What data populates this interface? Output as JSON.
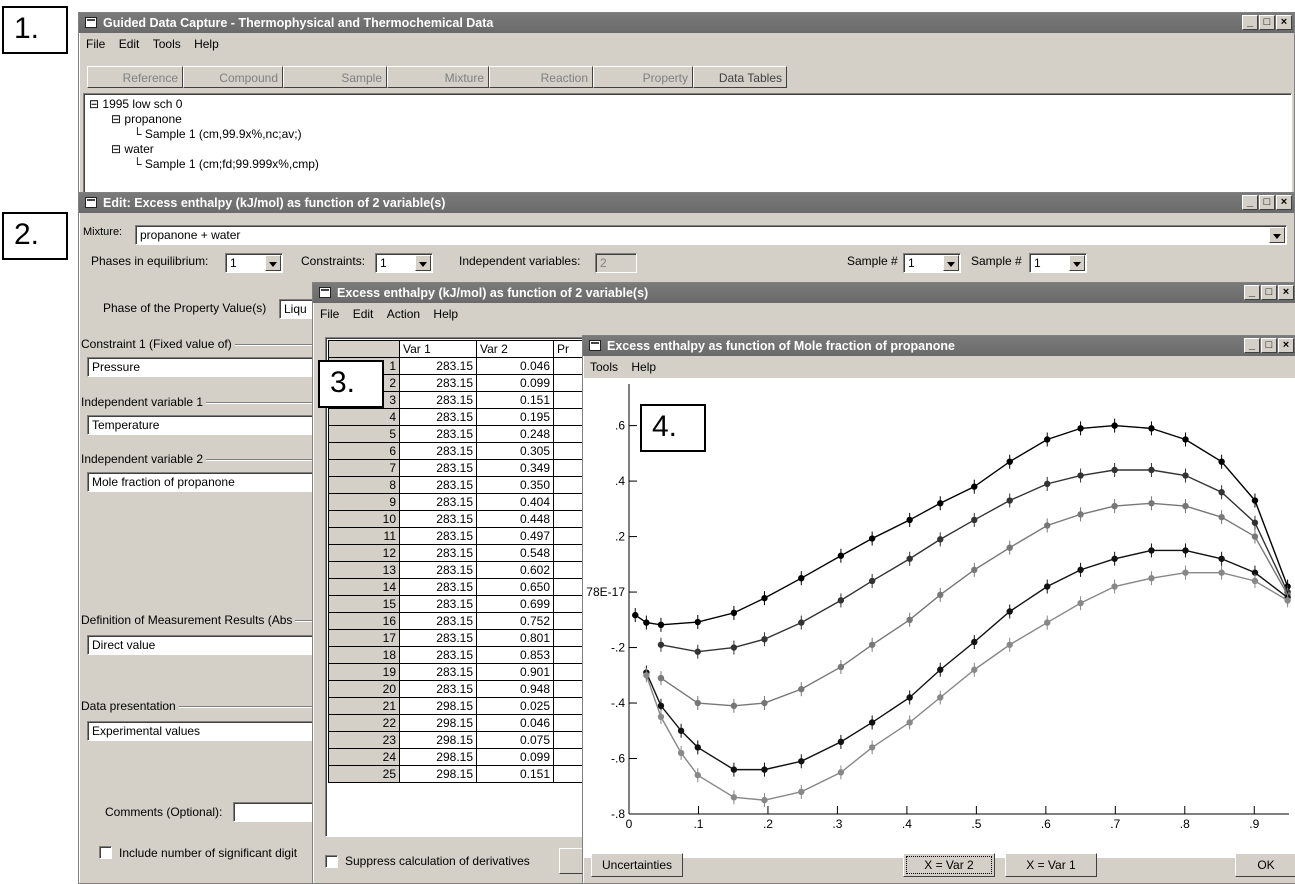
{
  "callouts": {
    "c1": "1.",
    "c2": "2.",
    "c3": "3.",
    "c4": "4."
  },
  "win1": {
    "title": "Guided Data Capture - Thermophysical and Thermochemical Data",
    "menu": [
      "File",
      "Edit",
      "Tools",
      "Help"
    ],
    "tabs": [
      "Reference",
      "Compound",
      "Sample",
      "Mixture",
      "Reaction",
      "Property",
      "Data Tables"
    ],
    "tree": {
      "root": "1995 low sch 0",
      "node1": "propanone",
      "node1_child": "Sample 1 (cm,99.9x%,nc;av;)",
      "node2": "water",
      "node2_child": "Sample 1 (cm;fd;99.999x%,cmp)"
    }
  },
  "win2": {
    "title": "Edit: Excess enthalpy (kJ/mol) as function of 2 variable(s)",
    "mixture_label": "Mixture:",
    "mixture_value": "propanone + water",
    "phases_label": "Phases in equilibrium:",
    "phases_value": "1",
    "constraints_label": "Constraints:",
    "constraints_value": "1",
    "indep_label": "Independent variables:",
    "indep_value": "2",
    "sample1_label": "Sample #",
    "sample1_value": "1",
    "sample2_label": "Sample #",
    "sample2_value": "1",
    "phase_prop_label": "Phase of the Property Value(s)",
    "phase_prop_value": "Liqu",
    "constraint1_label": "Constraint 1 (Fixed value of)",
    "constraint1_value": "Pressure",
    "indep1_label": "Independent variable 1",
    "indep1_value": "Temperature",
    "indep2_label": "Independent variable 2",
    "indep2_value": "Mole fraction of propanone",
    "definition_label": "Definition of Measurement Results (Abs",
    "definition_value": "Direct value",
    "presentation_label": "Data presentation",
    "presentation_value": "Experimental values",
    "comments_label": "Comments (Optional):",
    "sigdig_label": "Include number of significant digit"
  },
  "win3": {
    "title": "Excess enthalpy (kJ/mol) as function of 2 variable(s)",
    "menu": [
      "File",
      "Edit",
      "Action",
      "Help"
    ],
    "headers": [
      "Var 1",
      "Var 2",
      "Pr"
    ],
    "rows": [
      [
        "1",
        "283.15",
        "0.046"
      ],
      [
        "2",
        "283.15",
        "0.099"
      ],
      [
        "3",
        "283.15",
        "0.151"
      ],
      [
        "4",
        "283.15",
        "0.195"
      ],
      [
        "5",
        "283.15",
        "0.248"
      ],
      [
        "6",
        "283.15",
        "0.305"
      ],
      [
        "7",
        "283.15",
        "0.349"
      ],
      [
        "8",
        "283.15",
        "0.350"
      ],
      [
        "9",
        "283.15",
        "0.404"
      ],
      [
        "10",
        "283.15",
        "0.448"
      ],
      [
        "11",
        "283.15",
        "0.497"
      ],
      [
        "12",
        "283.15",
        "0.548"
      ],
      [
        "13",
        "283.15",
        "0.602"
      ],
      [
        "14",
        "283.15",
        "0.650"
      ],
      [
        "15",
        "283.15",
        "0.699"
      ],
      [
        "16",
        "283.15",
        "0.752"
      ],
      [
        "17",
        "283.15",
        "0.801"
      ],
      [
        "18",
        "283.15",
        "0.853"
      ],
      [
        "19",
        "283.15",
        "0.901"
      ],
      [
        "20",
        "283.15",
        "0.948"
      ],
      [
        "21",
        "298.15",
        "0.025"
      ],
      [
        "22",
        "298.15",
        "0.046"
      ],
      [
        "23",
        "298.15",
        "0.075"
      ],
      [
        "24",
        "298.15",
        "0.099"
      ],
      [
        "25",
        "298.15",
        "0.151"
      ]
    ],
    "suppress_label": "Suppress calculation of derivatives"
  },
  "win4": {
    "title": "Excess enthalpy as function of Mole fraction of propanone",
    "menu": [
      "Tools",
      "Help"
    ],
    "btn_uncert": "Uncertainties",
    "btn_var2": "X = Var 2",
    "btn_var1": "X = Var 1",
    "btn_ok": "OK"
  },
  "chart_data": {
    "type": "scatter",
    "xlim": [
      0,
      0.95
    ],
    "ylim": [
      -0.8,
      0.75
    ],
    "x_ticks": [
      "0",
      ".1",
      ".2",
      ".3",
      ".4",
      ".5",
      ".6",
      ".7",
      ".8",
      ".9"
    ],
    "y_ticks": [
      ".6",
      ".4",
      ".2",
      "78E-17",
      "-.2",
      "-.4",
      "-.6",
      "-.8"
    ],
    "error_bars": true,
    "series": [
      {
        "color": "#000000",
        "points": [
          [
            0.009,
            -0.083
          ],
          [
            0.025,
            -0.11
          ],
          [
            0.046,
            -0.118
          ],
          [
            0.099,
            -0.108
          ],
          [
            0.151,
            -0.075
          ],
          [
            0.195,
            -0.022
          ],
          [
            0.248,
            0.05
          ],
          [
            0.305,
            0.131
          ],
          [
            0.35,
            0.193
          ],
          [
            0.404,
            0.26
          ],
          [
            0.448,
            0.32
          ],
          [
            0.497,
            0.38
          ],
          [
            0.548,
            0.47
          ],
          [
            0.602,
            0.55
          ],
          [
            0.65,
            0.59
          ],
          [
            0.699,
            0.6
          ],
          [
            0.752,
            0.59
          ],
          [
            0.801,
            0.55
          ],
          [
            0.853,
            0.47
          ],
          [
            0.901,
            0.33
          ],
          [
            0.948,
            0.02
          ]
        ]
      },
      {
        "color": "#333333",
        "points": [
          [
            0.046,
            -0.19
          ],
          [
            0.099,
            -0.215
          ],
          [
            0.151,
            -0.2
          ],
          [
            0.195,
            -0.17
          ],
          [
            0.248,
            -0.11
          ],
          [
            0.305,
            -0.03
          ],
          [
            0.35,
            0.04
          ],
          [
            0.404,
            0.12
          ],
          [
            0.448,
            0.19
          ],
          [
            0.497,
            0.26
          ],
          [
            0.548,
            0.33
          ],
          [
            0.602,
            0.39
          ],
          [
            0.65,
            0.42
          ],
          [
            0.699,
            0.44
          ],
          [
            0.752,
            0.44
          ],
          [
            0.801,
            0.42
          ],
          [
            0.853,
            0.36
          ],
          [
            0.901,
            0.25
          ],
          [
            0.948,
            0.0
          ]
        ]
      },
      {
        "color": "#777777",
        "points": [
          [
            0.046,
            -0.31
          ],
          [
            0.099,
            -0.4
          ],
          [
            0.151,
            -0.41
          ],
          [
            0.195,
            -0.4
          ],
          [
            0.248,
            -0.35
          ],
          [
            0.305,
            -0.27
          ],
          [
            0.35,
            -0.19
          ],
          [
            0.404,
            -0.1
          ],
          [
            0.448,
            -0.01
          ],
          [
            0.497,
            0.08
          ],
          [
            0.548,
            0.16
          ],
          [
            0.602,
            0.24
          ],
          [
            0.65,
            0.28
          ],
          [
            0.699,
            0.31
          ],
          [
            0.752,
            0.32
          ],
          [
            0.801,
            0.31
          ],
          [
            0.853,
            0.27
          ],
          [
            0.901,
            0.2
          ],
          [
            0.948,
            -0.01
          ]
        ]
      },
      {
        "color": "#111111",
        "points": [
          [
            0.025,
            -0.29
          ],
          [
            0.046,
            -0.41
          ],
          [
            0.075,
            -0.5
          ],
          [
            0.099,
            -0.56
          ],
          [
            0.151,
            -0.64
          ],
          [
            0.195,
            -0.64
          ],
          [
            0.248,
            -0.61
          ],
          [
            0.305,
            -0.54
          ],
          [
            0.35,
            -0.47
          ],
          [
            0.404,
            -0.38
          ],
          [
            0.448,
            -0.28
          ],
          [
            0.497,
            -0.18
          ],
          [
            0.548,
            -0.07
          ],
          [
            0.602,
            0.02
          ],
          [
            0.65,
            0.08
          ],
          [
            0.699,
            0.12
          ],
          [
            0.752,
            0.15
          ],
          [
            0.801,
            0.15
          ],
          [
            0.853,
            0.12
          ],
          [
            0.901,
            0.07
          ],
          [
            0.948,
            -0.02
          ]
        ]
      },
      {
        "color": "#888888",
        "points": [
          [
            0.025,
            -0.3
          ],
          [
            0.046,
            -0.45
          ],
          [
            0.075,
            -0.58
          ],
          [
            0.099,
            -0.66
          ],
          [
            0.151,
            -0.74
          ],
          [
            0.195,
            -0.75
          ],
          [
            0.248,
            -0.72
          ],
          [
            0.305,
            -0.65
          ],
          [
            0.35,
            -0.56
          ],
          [
            0.404,
            -0.47
          ],
          [
            0.448,
            -0.38
          ],
          [
            0.497,
            -0.28
          ],
          [
            0.548,
            -0.19
          ],
          [
            0.602,
            -0.11
          ],
          [
            0.65,
            -0.04
          ],
          [
            0.699,
            0.02
          ],
          [
            0.752,
            0.05
          ],
          [
            0.801,
            0.07
          ],
          [
            0.853,
            0.07
          ],
          [
            0.901,
            0.04
          ],
          [
            0.948,
            -0.03
          ]
        ]
      }
    ]
  }
}
